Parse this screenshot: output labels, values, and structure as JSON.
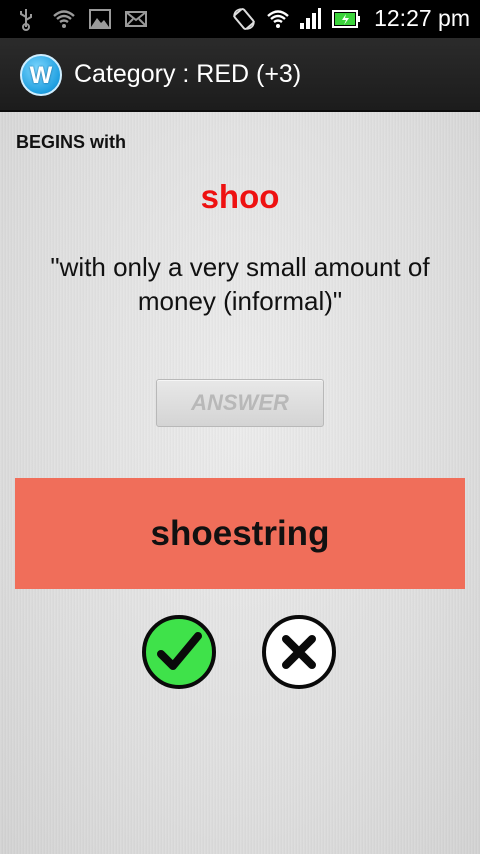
{
  "status_bar": {
    "time": "12:27 pm",
    "icons": [
      "usb-icon",
      "wifi-icon",
      "image-icon",
      "mail-icon",
      "rotate-icon",
      "wifi-signal-icon",
      "cell-signal-icon",
      "battery-icon"
    ]
  },
  "action_bar": {
    "logo_letter": "W",
    "title": "Category : RED (+3)"
  },
  "quiz": {
    "begins_label": "BEGINS with",
    "word": "shoo",
    "definition": "\"with only a very small amount of money (informal)\"",
    "answer_button": "ANSWER",
    "answer": "shoestring"
  },
  "colors": {
    "word": "#ee1111",
    "answer_bg": "#f06e5a",
    "correct_green": "#3fe24a"
  }
}
